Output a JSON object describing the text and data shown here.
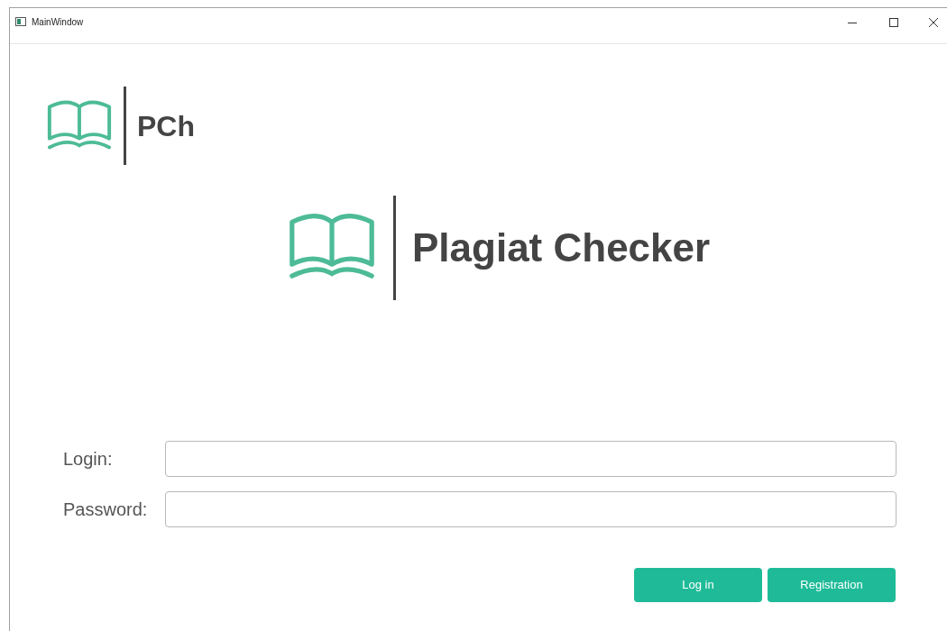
{
  "window": {
    "title": "MainWindow"
  },
  "small_logo": {
    "text": "PCh"
  },
  "large_logo": {
    "text": "Plagiat Checker"
  },
  "fields": [
    {
      "label": "Login:"
    },
    {
      "label": "Password:"
    }
  ],
  "buttons": [
    {
      "label": "Log in"
    },
    {
      "label": "Registration"
    }
  ]
}
